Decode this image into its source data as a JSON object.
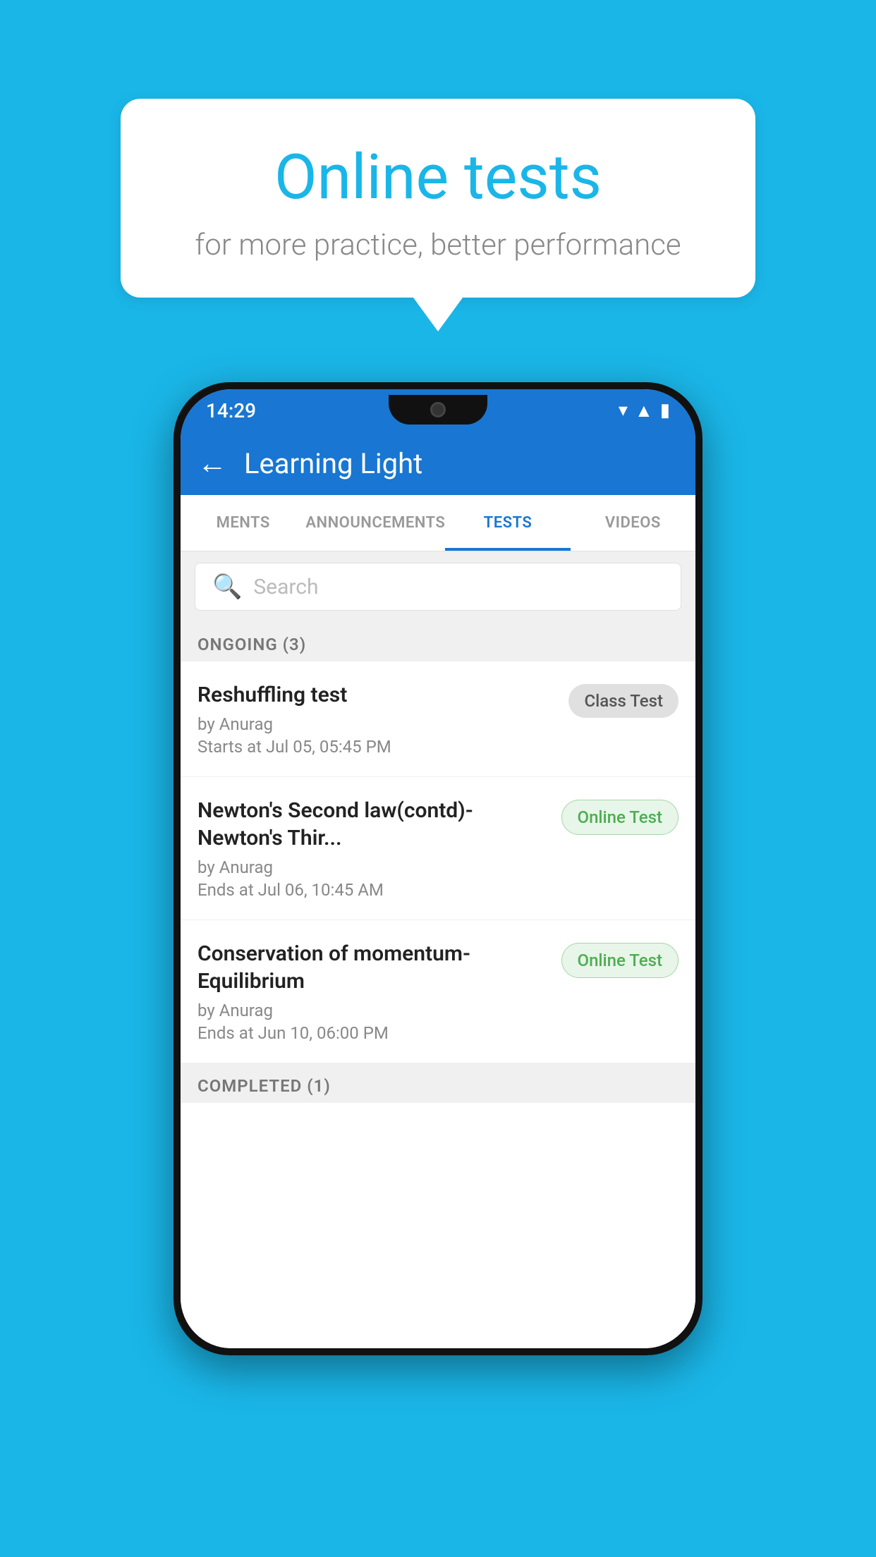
{
  "background_color": "#1ab6e8",
  "speech_bubble": {
    "title": "Online tests",
    "subtitle": "for more practice, better performance"
  },
  "phone": {
    "status_bar": {
      "time": "14:29",
      "icons": [
        "wifi",
        "signal",
        "battery"
      ]
    },
    "app_bar": {
      "title": "Learning Light",
      "back_label": "←"
    },
    "tabs": [
      {
        "label": "MENTS",
        "active": false
      },
      {
        "label": "ANNOUNCEMENTS",
        "active": false
      },
      {
        "label": "TESTS",
        "active": true
      },
      {
        "label": "VIDEOS",
        "active": false
      }
    ],
    "search": {
      "placeholder": "Search"
    },
    "ongoing_section": {
      "label": "ONGOING (3)"
    },
    "test_items": [
      {
        "name": "Reshuffling test",
        "author": "by Anurag",
        "date_label": "Starts at",
        "date": "Jul 05, 05:45 PM",
        "badge": "Class Test",
        "badge_type": "class"
      },
      {
        "name": "Newton's Second law(contd)-Newton's Thir...",
        "author": "by Anurag",
        "date_label": "Ends at",
        "date": "Jul 06, 10:45 AM",
        "badge": "Online Test",
        "badge_type": "online"
      },
      {
        "name": "Conservation of momentum-Equilibrium",
        "author": "by Anurag",
        "date_label": "Ends at",
        "date": "Jun 10, 06:00 PM",
        "badge": "Online Test",
        "badge_type": "online"
      }
    ],
    "completed_section": {
      "label": "COMPLETED (1)"
    }
  }
}
